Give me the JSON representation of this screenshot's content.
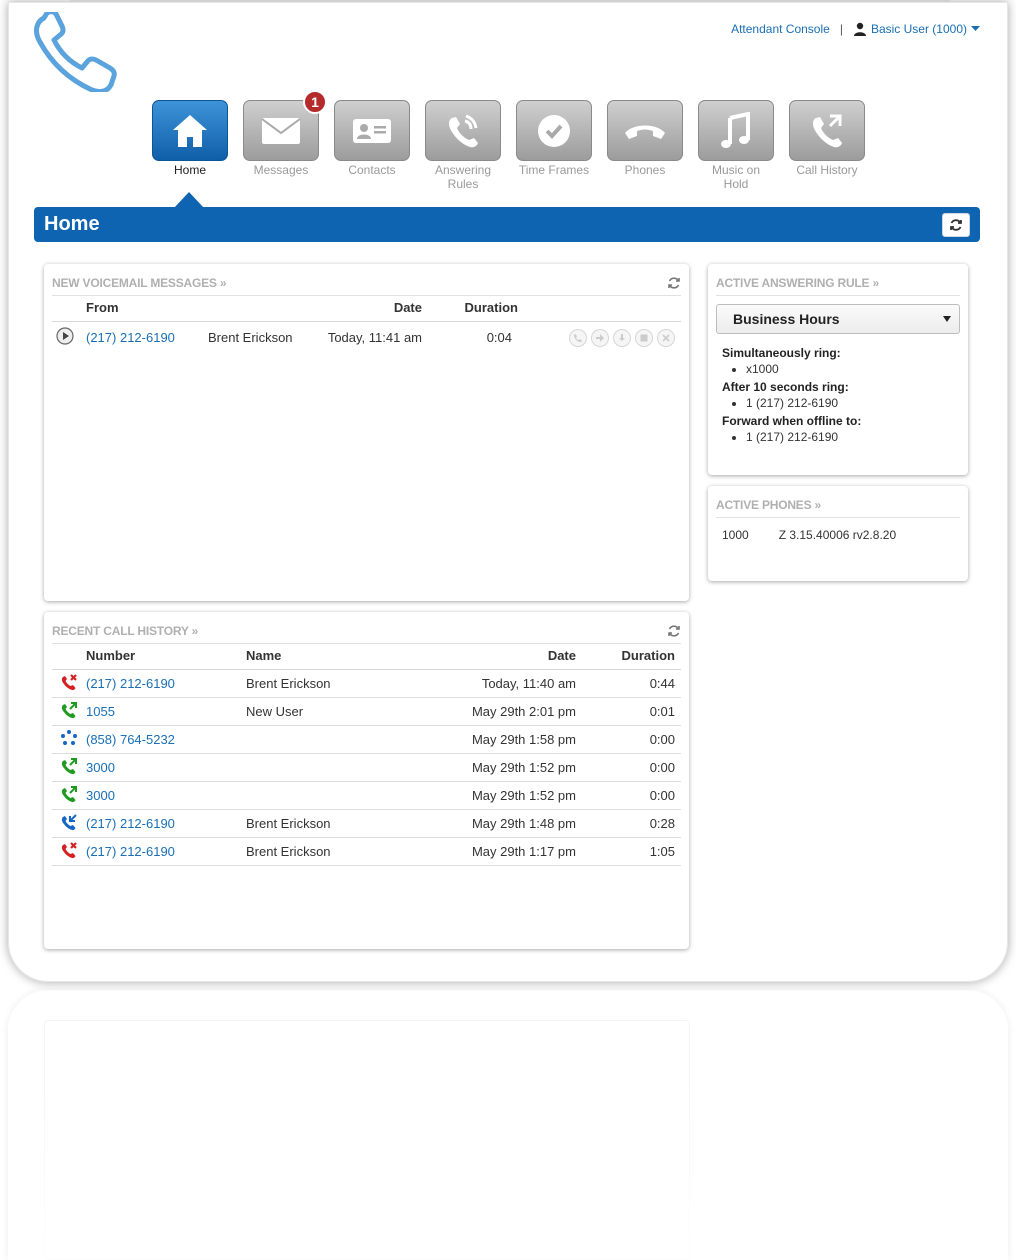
{
  "topnav": {
    "attendant_console": "Attendant Console",
    "separator": "|",
    "user_label": "Basic User (1000)"
  },
  "tiles": [
    {
      "label": "Home",
      "icon": "home-icon",
      "active": true
    },
    {
      "label": "Messages",
      "icon": "envelope-icon",
      "badge": "1"
    },
    {
      "label": "Contacts",
      "icon": "contact-card-icon"
    },
    {
      "label": "Answering Rules",
      "icon": "answering-rules-icon"
    },
    {
      "label": "Time Frames",
      "icon": "clock-icon"
    },
    {
      "label": "Phones",
      "icon": "phone-handset-icon"
    },
    {
      "label": "Music on Hold",
      "icon": "music-note-icon"
    },
    {
      "label": "Call History",
      "icon": "call-history-icon"
    }
  ],
  "page": {
    "title": "Home"
  },
  "voicemail": {
    "title": "NEW VOICEMAIL MESSAGES »",
    "headers": {
      "from": "From",
      "date": "Date",
      "duration": "Duration"
    },
    "rows": [
      {
        "number": "(217) 212-6190",
        "name": "Brent Erickson",
        "date": "Today, 11:41 am",
        "duration": "0:04"
      }
    ]
  },
  "call_history": {
    "title": "RECENT CALL HISTORY »",
    "headers": {
      "number": "Number",
      "name": "Name",
      "date": "Date",
      "duration": "Duration"
    },
    "rows": [
      {
        "type": "missed",
        "number": "(217) 212-6190",
        "name": "Brent Erickson",
        "date": "Today, 11:40 am",
        "duration": "0:44"
      },
      {
        "type": "outgoing",
        "number": "1055",
        "name": "New User",
        "date": "May 29th 2:01 pm",
        "duration": "0:01"
      },
      {
        "type": "dialpad",
        "number": "(858) 764-5232",
        "name": "",
        "date": "May 29th 1:58 pm",
        "duration": "0:00"
      },
      {
        "type": "outgoing",
        "number": "3000",
        "name": "",
        "date": "May 29th 1:52 pm",
        "duration": "0:00"
      },
      {
        "type": "outgoing",
        "number": "3000",
        "name": "",
        "date": "May 29th 1:52 pm",
        "duration": "0:00"
      },
      {
        "type": "incoming",
        "number": "(217) 212-6190",
        "name": "Brent Erickson",
        "date": "May 29th 1:48 pm",
        "duration": "0:28"
      },
      {
        "type": "missed",
        "number": "(217) 212-6190",
        "name": "Brent Erickson",
        "date": "May 29th 1:17 pm",
        "duration": "1:05"
      }
    ]
  },
  "answering_rule": {
    "title": "ACTIVE ANSWERING RULE »",
    "selected": "Business Hours",
    "sections": [
      {
        "label": "Simultaneously ring:",
        "items": [
          "x1000"
        ]
      },
      {
        "label": "After 10 seconds ring:",
        "items": [
          "1 (217) 212-6190"
        ]
      },
      {
        "label": "Forward when offline to:",
        "items": [
          "1 (217) 212-6190"
        ]
      }
    ]
  },
  "active_phones": {
    "title": "ACTIVE PHONES »",
    "rows": [
      {
        "ext": "1000",
        "model": "Z 3.15.40006 rv2.8.20"
      }
    ]
  },
  "colors": {
    "accent": "#0e64b1",
    "link": "#1a6fb5",
    "missed": "#d62020",
    "outgoing": "#1f9a1f",
    "incoming": "#1666c6",
    "badge": "#b52a2a"
  }
}
